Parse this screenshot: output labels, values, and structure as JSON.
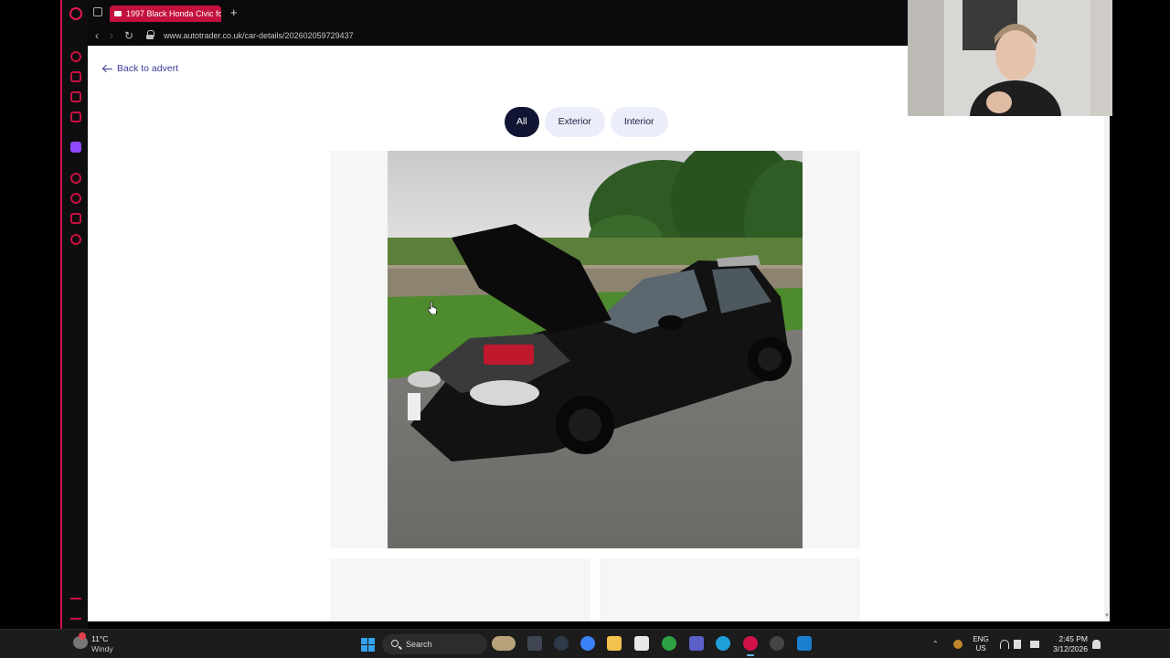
{
  "browser": {
    "tab_title": "1997 Black Honda Civic for",
    "new_tab_label": "+",
    "url": "www.autotrader.co.uk/car-details/202602059729437"
  },
  "page": {
    "back_link": "Back to advert",
    "filters": [
      {
        "label": "All",
        "active": true
      },
      {
        "label": "Exterior",
        "active": false
      },
      {
        "label": "Interior",
        "active": false
      }
    ],
    "main_image": "Black Honda Civic hatchback, bonnet open showing red engine cover, parked on tarmac beside grass and trees"
  },
  "taskbar": {
    "weather_temp": "11°C",
    "weather_condition": "Windy",
    "search_label": "Search",
    "lang_top": "ENG",
    "lang_bottom": "US",
    "time": "2:45 PM",
    "date": "3/12/2026"
  },
  "colors": {
    "accent": "#c4103d",
    "active_pill": "#111533",
    "link": "#3b3b9a"
  }
}
